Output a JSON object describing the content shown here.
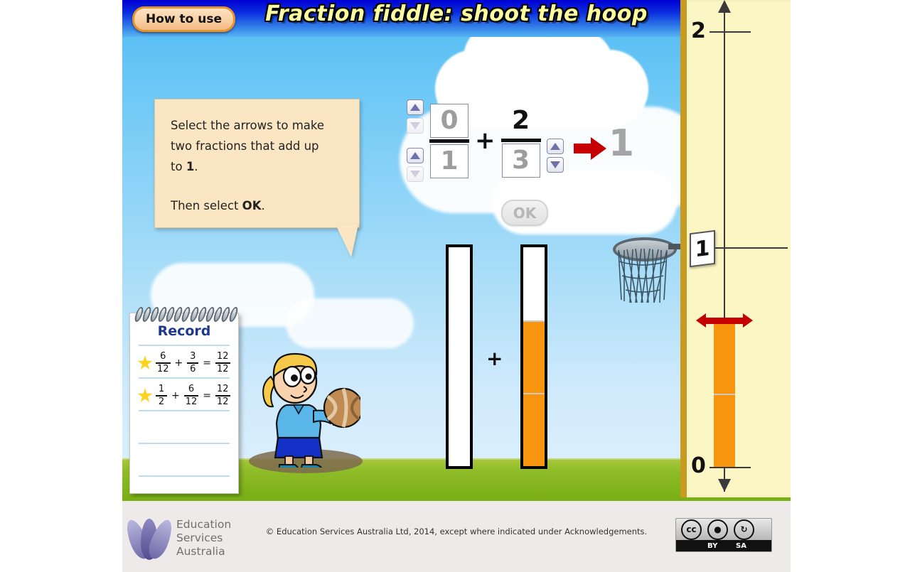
{
  "app": {
    "title": "Fraction fiddle: shoot the hoop",
    "how_to_use_label": "How to use"
  },
  "instructions": {
    "line1": "Select the arrows to make",
    "line2": "two fractions that add up",
    "line3_pre": "to ",
    "line3_bold": "1",
    "line3_post": ".",
    "line4_pre": "Then select ",
    "line4_bold": "OK",
    "line4_post": "."
  },
  "expression": {
    "fraction1": {
      "numerator": "0",
      "denominator": "1"
    },
    "operator": "+",
    "fraction2": {
      "numerator": "2",
      "denominator": "3"
    },
    "target": "1",
    "ok_label": "OK",
    "ok_enabled": false
  },
  "bars": {
    "plus": "+",
    "left_filled": 0,
    "left_total": 1,
    "right_filled": 2,
    "right_total": 3
  },
  "numberline": {
    "label_top": "2",
    "label_mid": "1",
    "label_bottom": "0",
    "bar_filled": 2,
    "bar_total": 3
  },
  "record": {
    "title": "Record",
    "rows": [
      {
        "a_num": "6",
        "a_den": "12",
        "op": "+",
        "b_num": "3",
        "b_den": "6",
        "eq": "=",
        "c_num": "12",
        "c_den": "12",
        "starred": true
      },
      {
        "a_num": "1",
        "a_den": "2",
        "op": "+",
        "b_num": "6",
        "b_den": "12",
        "eq": "=",
        "c_num": "12",
        "c_den": "12",
        "starred": true
      }
    ]
  },
  "footer": {
    "org_line1": "Education",
    "org_line2": "Services",
    "org_line3": "Australia",
    "copyright": "© Education Services Australia Ltd, 2014, except where indicated under Acknowledgements.",
    "cc_by": "BY",
    "cc_sa": "SA",
    "cc_mark": "cc"
  },
  "colors": {
    "sky": "#6dc8f6",
    "orange": "#f7960e",
    "panel": "#fbf6c3",
    "title_yellow": "#ffffa0",
    "red": "#c60000",
    "grass": "#7ab015"
  }
}
